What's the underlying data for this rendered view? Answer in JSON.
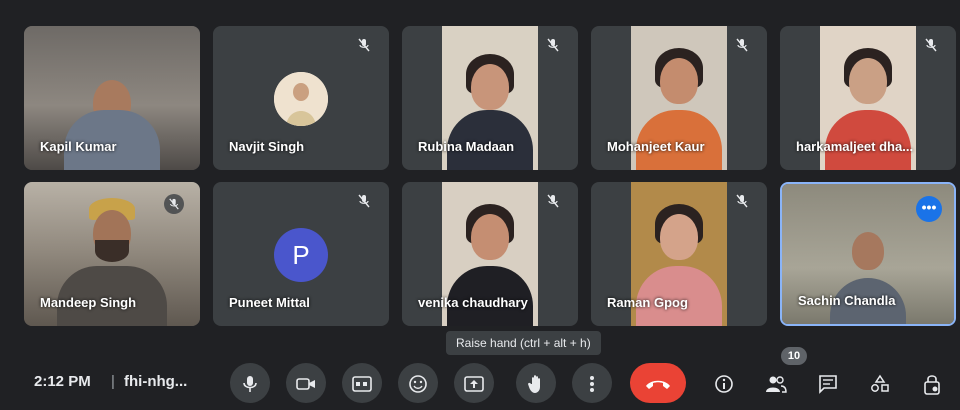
{
  "participants": [
    {
      "name": "Kapil Kumar"
    },
    {
      "name": "Navjit Singh"
    },
    {
      "name": "Rubina Madaan"
    },
    {
      "name": "Mohanjeet Kaur"
    },
    {
      "name": "harkamaljeet dha..."
    },
    {
      "name": "Mandeep Singh"
    },
    {
      "name": "Puneet Mittal",
      "avatar_letter": "P"
    },
    {
      "name": "venika chaudhary"
    },
    {
      "name": "Raman Gpog"
    },
    {
      "name": "Sachin Chandla"
    }
  ],
  "tooltip": "Raise hand (ctrl + alt + h)",
  "meeting": {
    "time": "2:12 PM",
    "separator": "|",
    "code": "fhi-nhg..."
  },
  "people_count": "10",
  "icons": {
    "more": "•••",
    "mic_off": "✕"
  },
  "colors": {
    "background": "#202124",
    "tile": "#3c4043",
    "accent": "#8ab4f8",
    "end_call": "#ea4335",
    "avatar_letter_bg": "#4a56cc"
  }
}
